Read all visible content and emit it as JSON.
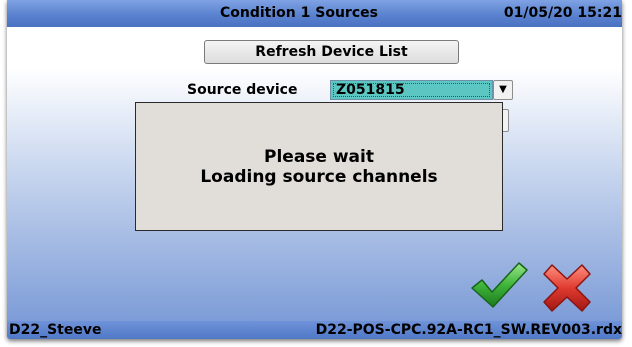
{
  "header": {
    "title": "Condition 1 Sources",
    "datetime": "01/05/20 15:21"
  },
  "toolbar": {
    "refresh_label": "Refresh Device List"
  },
  "source": {
    "label": "Source device",
    "selected": "Z051815",
    "arrow": "▼"
  },
  "dialog": {
    "line1": "Please wait",
    "line2": "Loading source channels"
  },
  "actions": {
    "ok_icon": "green-checkmark-icon",
    "cancel_icon": "red-x-icon"
  },
  "status": {
    "user": "D22_Steeve",
    "file": "D22-POS-CPC.92A-RC1_SW.REV003.rdx"
  },
  "colors": {
    "titlebar": "#5a82cf",
    "selection": "#5cc7c2",
    "dialog_bg": "#e1ddd9",
    "ok": "#2fa12f",
    "cancel": "#d82b2b"
  }
}
